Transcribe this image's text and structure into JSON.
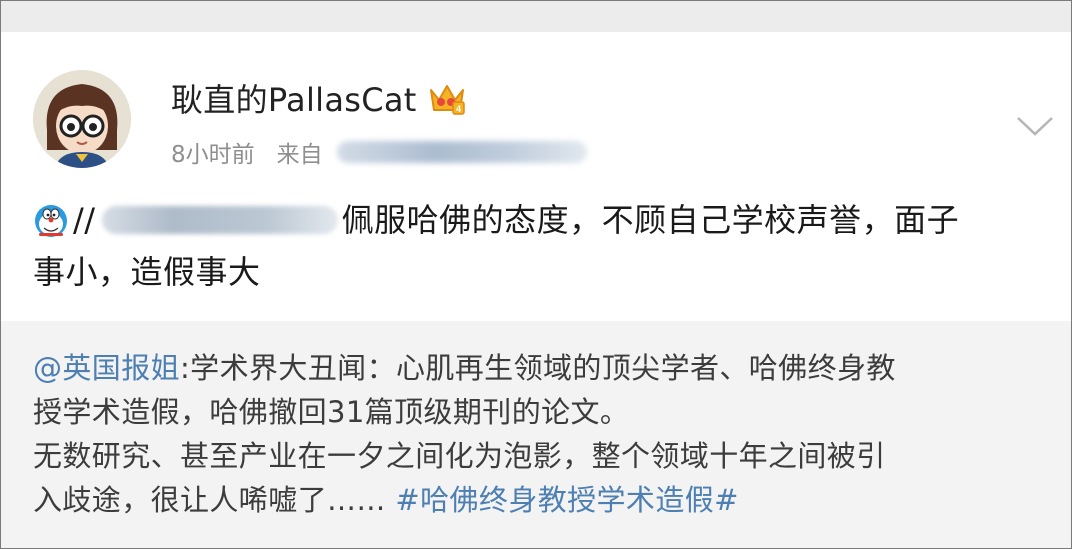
{
  "post": {
    "author": "耿直的PallasCat",
    "time_ago": "8小时前",
    "source_prefix": "来自",
    "text_prefix": "//",
    "text_line1": "佩服哈佛的态度，不顾自己学校声誉，面子",
    "text_line2": "事小，造假事大"
  },
  "repost": {
    "mention": "@英国报姐",
    "line1_rest": ":学术界大丑闻：心肌再生领域的顶尖学者、哈佛终身教",
    "line2": "授学术造假，哈佛撤回31篇顶级期刊的论文。",
    "line3": "无数研究、甚至产业在一夕之间化为泡影，整个领域十年之间被引",
    "line4_text": "入歧途，很让人唏嘘了…… ",
    "hashtag": "#哈佛终身教授学术造假#"
  },
  "icons": {
    "avatar": "cartoon-girl-with-glasses",
    "badge": "crown-icon",
    "emoji": "doraemon-icon",
    "menu": "chevron-down-icon"
  },
  "colors": {
    "link": "#4d7fb2",
    "repost_bg": "#f3f3f3",
    "meta": "#8f8f8f"
  }
}
